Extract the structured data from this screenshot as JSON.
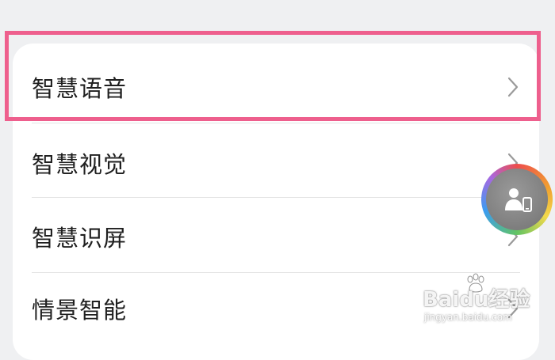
{
  "settings_list": {
    "items": [
      {
        "label": "智慧语音"
      },
      {
        "label": "智慧视觉"
      },
      {
        "label": "智慧识屏"
      },
      {
        "label": "情景智能"
      }
    ]
  },
  "floating_assistant": {
    "icon": "person-phone-icon"
  },
  "watermark": {
    "brand": "Baidu经验",
    "url": "jingyan.baidu.com"
  },
  "colors": {
    "highlight": "#ee5f8d",
    "background": "#eff0f2",
    "card": "#ffffff"
  }
}
